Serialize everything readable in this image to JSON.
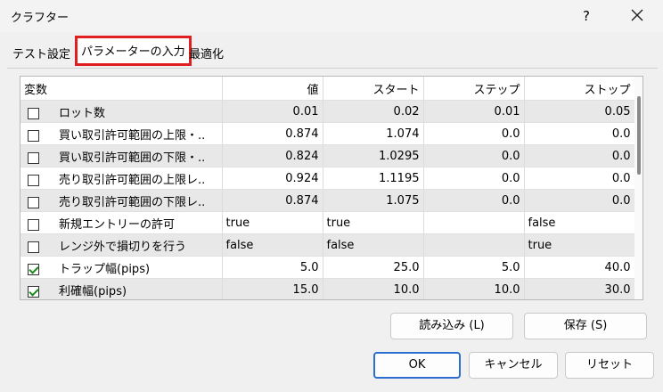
{
  "window": {
    "title": "クラフター",
    "help_label": "?"
  },
  "tabs": [
    {
      "label": "テスト設定"
    },
    {
      "label": "パラメーターの入力"
    },
    {
      "label": "最適化"
    }
  ],
  "table": {
    "headers": [
      "変数",
      "値",
      "スタート",
      "ステップ",
      "ストップ"
    ],
    "rows": [
      {
        "checked": false,
        "name": "ロット数",
        "value": "0.01",
        "start": "0.02",
        "step": "0.01",
        "stop": "0.05",
        "shaded": true
      },
      {
        "checked": false,
        "name": "買い取引許可範囲の上限・..",
        "value": "0.874",
        "start": "1.074",
        "step": "0.0",
        "stop": "0.0",
        "shaded": false
      },
      {
        "checked": false,
        "name": "買い取引許可範囲の下限・..",
        "value": "0.824",
        "start": "1.0295",
        "step": "0.0",
        "stop": "0.0",
        "shaded": true
      },
      {
        "checked": false,
        "name": "売り取引許可範囲の上限レ..",
        "value": "0.924",
        "start": "1.1195",
        "step": "0.0",
        "stop": "0.0",
        "shaded": false
      },
      {
        "checked": false,
        "name": "売り取引許可範囲の下限レ..",
        "value": "0.874",
        "start": "1.075",
        "step": "0.0",
        "stop": "0.0",
        "shaded": true
      },
      {
        "checked": false,
        "name": "新規エントリーの許可",
        "value": "true",
        "start": "true",
        "step": "",
        "stop": "false",
        "shaded": false
      },
      {
        "checked": false,
        "name": "レンジ外で損切りを行う",
        "value": "false",
        "start": "false",
        "step": "",
        "stop": "true",
        "shaded": true
      },
      {
        "checked": true,
        "name": "トラップ幅(pips)",
        "value": "5.0",
        "start": "25.0",
        "step": "5.0",
        "stop": "40.0",
        "shaded": false
      },
      {
        "checked": true,
        "name": "利確幅(pips)",
        "value": "15.0",
        "start": "10.0",
        "step": "10.0",
        "stop": "30.0",
        "shaded": true
      }
    ]
  },
  "buttons": {
    "load": "読み込み (L)",
    "save": "保存 (S)",
    "ok": "OK",
    "cancel": "キャンセル",
    "reset": "リセット"
  }
}
